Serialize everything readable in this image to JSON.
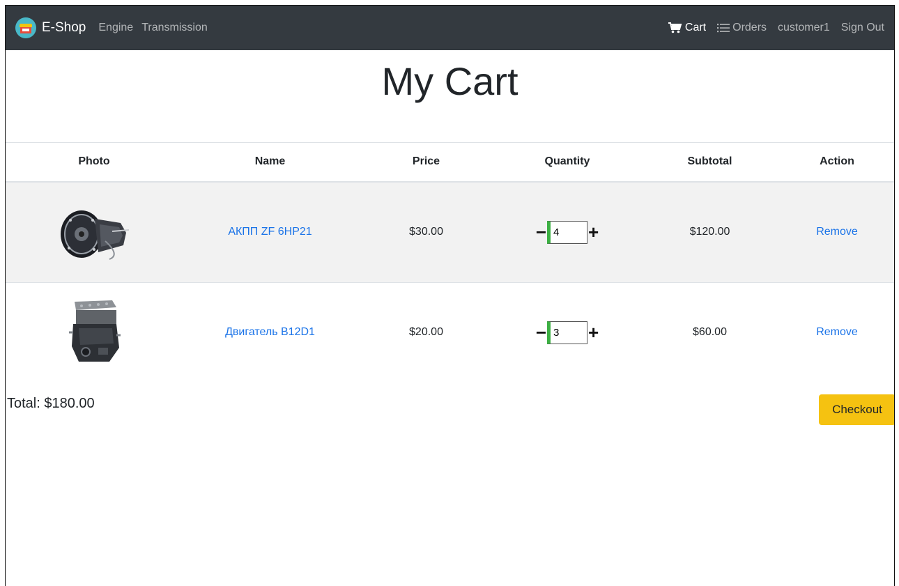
{
  "navbar": {
    "brand": "E-Shop",
    "left_links": [
      "Engine",
      "Transmission"
    ],
    "cart": "Cart",
    "orders": "Orders",
    "user": "customer1",
    "signout": "Sign Out",
    "icons": {
      "brand": "shop-logo-icon",
      "cart": "cart-icon",
      "orders": "list-icon"
    }
  },
  "page": {
    "title": "My Cart"
  },
  "table": {
    "headers": [
      "Photo",
      "Name",
      "Price",
      "Quantity",
      "Subtotal",
      "Action"
    ],
    "rows": [
      {
        "photo": "transmission-photo",
        "name": "АКПП ZF 6HP21",
        "price": "$30.00",
        "quantity": "4",
        "subtotal": "$120.00",
        "action": "Remove"
      },
      {
        "photo": "engine-photo",
        "name": "Двигатель B12D1",
        "price": "$20.00",
        "quantity": "3",
        "subtotal": "$60.00",
        "action": "Remove"
      }
    ],
    "qty_minus": "−",
    "qty_plus": "+"
  },
  "summary": {
    "total": "Total: $180.00",
    "checkout": "Checkout"
  },
  "colors": {
    "navbar": "#343a40",
    "link": "#1a73e8",
    "checkout": "#f5c211",
    "qty_accent": "#3cb043"
  }
}
